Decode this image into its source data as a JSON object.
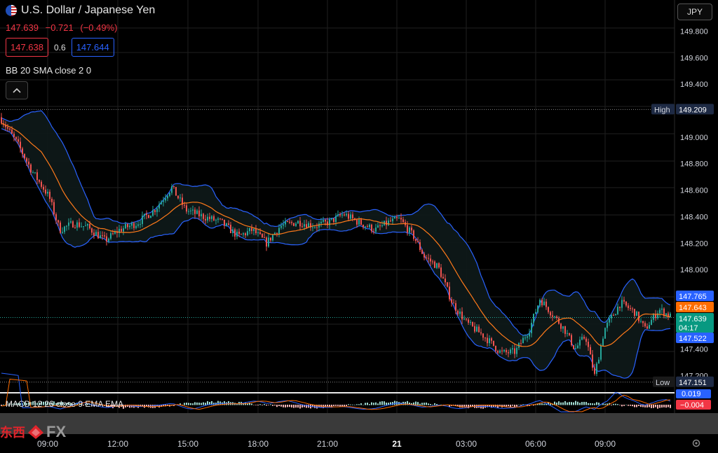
{
  "header": {
    "title": "U.S. Dollar / Japanese Yen",
    "price": "147.639",
    "change": "−0.721",
    "change_pct": "(−0.49%)",
    "bid": "147.638",
    "spread": "0.6",
    "ask": "147.644",
    "indicator": "BB 20 SMA close 2 0",
    "currency": "JPY"
  },
  "macd": {
    "label": "MACD 12 26 close 9 EMA EMA",
    "value_1": "0.019",
    "value_2": "−0.004"
  },
  "price_axis": {
    "ticks": [
      "149.800",
      "149.600",
      "149.400",
      "149.000",
      "148.800",
      "148.600",
      "148.400",
      "148.200",
      "148.000",
      "147.400",
      "147.200"
    ],
    "high_label": "High",
    "high_value": "149.209",
    "low_label": "Low",
    "low_value": "147.151",
    "upper_band": "147.765",
    "middle_band": "147.643",
    "current": "147.639",
    "countdown": "04:17",
    "lower_band": "147.522"
  },
  "time_axis": [
    "09:00",
    "12:00",
    "15:00",
    "18:00",
    "21:00",
    "21",
    "03:00",
    "06:00",
    "09:00"
  ],
  "logo": {
    "chinese": "东西",
    "fx": "FX"
  },
  "colors": {
    "up": "#26a69a",
    "down": "#ef5350",
    "band": "#2962ff",
    "sma": "#ff7a1a",
    "bg": "#000000"
  },
  "chart_data": {
    "type": "line",
    "x": [
      "09:00",
      "12:00",
      "15:00",
      "18:00",
      "21:00",
      "21",
      "03:00",
      "06:00",
      "09:00"
    ],
    "series": [
      {
        "name": "",
        "values": [
          149.15,
          148.35,
          148.62,
          148.28,
          148.36,
          148.38,
          147.95,
          147.55,
          147.64
        ]
      }
    ],
    "ylim": [
      147.15,
      149.85
    ],
    "grid": true
  }
}
